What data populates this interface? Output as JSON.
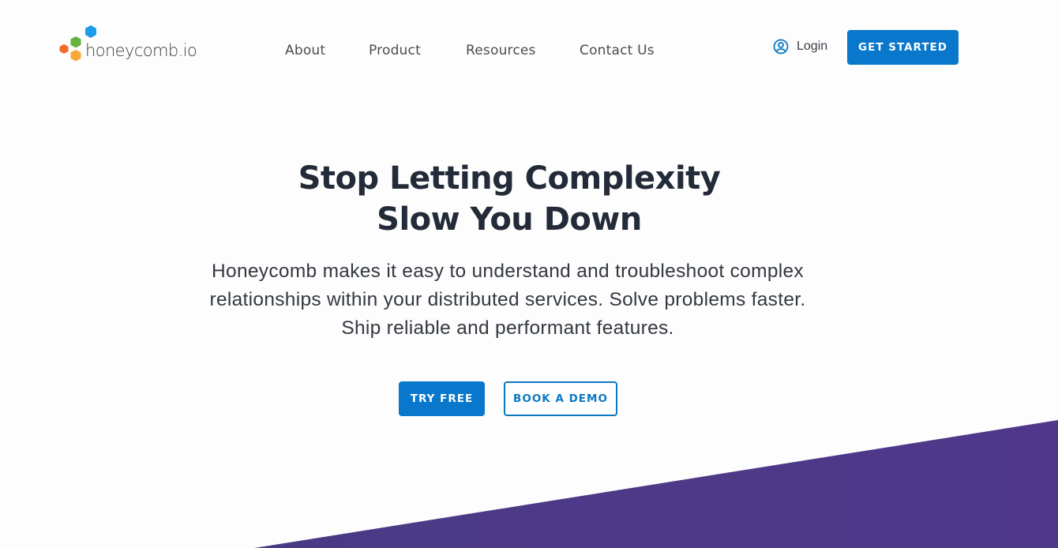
{
  "brand": {
    "name": "honeycomb.io",
    "colors": {
      "hex_blue": "#1b9be8",
      "hex_green": "#64b33e",
      "hex_orange_red": "#f26b2a",
      "hex_yellow": "#f8a93a"
    }
  },
  "nav": {
    "items": [
      {
        "label": "About"
      },
      {
        "label": "Product"
      },
      {
        "label": "Resources"
      },
      {
        "label": "Contact Us"
      }
    ]
  },
  "header": {
    "login_label": "Login",
    "login_icon": "user-circle-icon",
    "get_started_label": "GET STARTED"
  },
  "hero": {
    "title_line1": "Stop Letting Complexity",
    "title_line2": "Slow You Down",
    "subtitle_line1": "Honeycomb makes it easy to understand and troubleshoot complex",
    "subtitle_line2": "relationships within your distributed services. Solve problems faster.",
    "subtitle_line3": "Ship reliable and performant features.",
    "primary_cta": "TRY FREE",
    "secondary_cta": "BOOK A DEMO"
  },
  "theme": {
    "accent": "#0978cc",
    "heading": "#232a38",
    "wedge": "#4c3a86"
  }
}
